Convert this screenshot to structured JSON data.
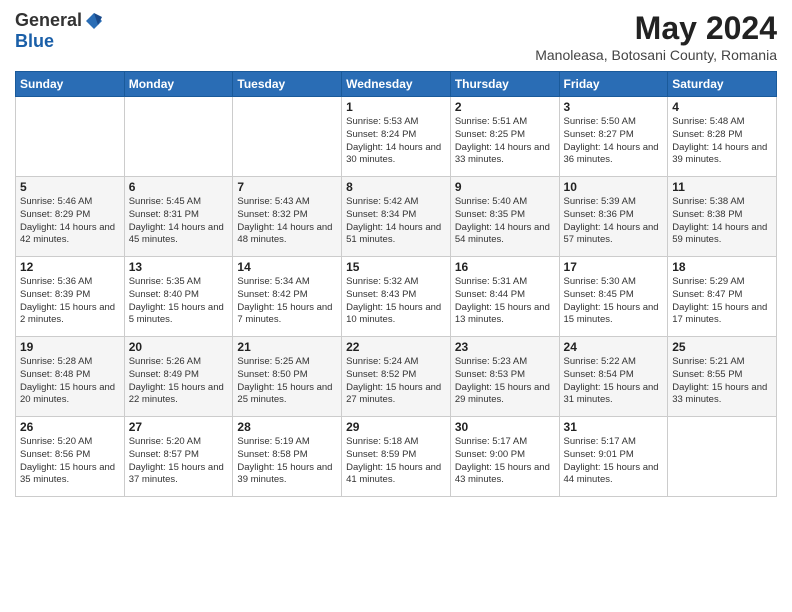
{
  "header": {
    "logo_general": "General",
    "logo_blue": "Blue",
    "title": "May 2024",
    "location": "Manoleasa, Botosani County, Romania"
  },
  "columns": [
    "Sunday",
    "Monday",
    "Tuesday",
    "Wednesday",
    "Thursday",
    "Friday",
    "Saturday"
  ],
  "weeks": [
    [
      {
        "day": "",
        "info": ""
      },
      {
        "day": "",
        "info": ""
      },
      {
        "day": "",
        "info": ""
      },
      {
        "day": "1",
        "info": "Sunrise: 5:53 AM\nSunset: 8:24 PM\nDaylight: 14 hours\nand 30 minutes."
      },
      {
        "day": "2",
        "info": "Sunrise: 5:51 AM\nSunset: 8:25 PM\nDaylight: 14 hours\nand 33 minutes."
      },
      {
        "day": "3",
        "info": "Sunrise: 5:50 AM\nSunset: 8:27 PM\nDaylight: 14 hours\nand 36 minutes."
      },
      {
        "day": "4",
        "info": "Sunrise: 5:48 AM\nSunset: 8:28 PM\nDaylight: 14 hours\nand 39 minutes."
      }
    ],
    [
      {
        "day": "5",
        "info": "Sunrise: 5:46 AM\nSunset: 8:29 PM\nDaylight: 14 hours\nand 42 minutes."
      },
      {
        "day": "6",
        "info": "Sunrise: 5:45 AM\nSunset: 8:31 PM\nDaylight: 14 hours\nand 45 minutes."
      },
      {
        "day": "7",
        "info": "Sunrise: 5:43 AM\nSunset: 8:32 PM\nDaylight: 14 hours\nand 48 minutes."
      },
      {
        "day": "8",
        "info": "Sunrise: 5:42 AM\nSunset: 8:34 PM\nDaylight: 14 hours\nand 51 minutes."
      },
      {
        "day": "9",
        "info": "Sunrise: 5:40 AM\nSunset: 8:35 PM\nDaylight: 14 hours\nand 54 minutes."
      },
      {
        "day": "10",
        "info": "Sunrise: 5:39 AM\nSunset: 8:36 PM\nDaylight: 14 hours\nand 57 minutes."
      },
      {
        "day": "11",
        "info": "Sunrise: 5:38 AM\nSunset: 8:38 PM\nDaylight: 14 hours\nand 59 minutes."
      }
    ],
    [
      {
        "day": "12",
        "info": "Sunrise: 5:36 AM\nSunset: 8:39 PM\nDaylight: 15 hours\nand 2 minutes."
      },
      {
        "day": "13",
        "info": "Sunrise: 5:35 AM\nSunset: 8:40 PM\nDaylight: 15 hours\nand 5 minutes."
      },
      {
        "day": "14",
        "info": "Sunrise: 5:34 AM\nSunset: 8:42 PM\nDaylight: 15 hours\nand 7 minutes."
      },
      {
        "day": "15",
        "info": "Sunrise: 5:32 AM\nSunset: 8:43 PM\nDaylight: 15 hours\nand 10 minutes."
      },
      {
        "day": "16",
        "info": "Sunrise: 5:31 AM\nSunset: 8:44 PM\nDaylight: 15 hours\nand 13 minutes."
      },
      {
        "day": "17",
        "info": "Sunrise: 5:30 AM\nSunset: 8:45 PM\nDaylight: 15 hours\nand 15 minutes."
      },
      {
        "day": "18",
        "info": "Sunrise: 5:29 AM\nSunset: 8:47 PM\nDaylight: 15 hours\nand 17 minutes."
      }
    ],
    [
      {
        "day": "19",
        "info": "Sunrise: 5:28 AM\nSunset: 8:48 PM\nDaylight: 15 hours\nand 20 minutes."
      },
      {
        "day": "20",
        "info": "Sunrise: 5:26 AM\nSunset: 8:49 PM\nDaylight: 15 hours\nand 22 minutes."
      },
      {
        "day": "21",
        "info": "Sunrise: 5:25 AM\nSunset: 8:50 PM\nDaylight: 15 hours\nand 25 minutes."
      },
      {
        "day": "22",
        "info": "Sunrise: 5:24 AM\nSunset: 8:52 PM\nDaylight: 15 hours\nand 27 minutes."
      },
      {
        "day": "23",
        "info": "Sunrise: 5:23 AM\nSunset: 8:53 PM\nDaylight: 15 hours\nand 29 minutes."
      },
      {
        "day": "24",
        "info": "Sunrise: 5:22 AM\nSunset: 8:54 PM\nDaylight: 15 hours\nand 31 minutes."
      },
      {
        "day": "25",
        "info": "Sunrise: 5:21 AM\nSunset: 8:55 PM\nDaylight: 15 hours\nand 33 minutes."
      }
    ],
    [
      {
        "day": "26",
        "info": "Sunrise: 5:20 AM\nSunset: 8:56 PM\nDaylight: 15 hours\nand 35 minutes."
      },
      {
        "day": "27",
        "info": "Sunrise: 5:20 AM\nSunset: 8:57 PM\nDaylight: 15 hours\nand 37 minutes."
      },
      {
        "day": "28",
        "info": "Sunrise: 5:19 AM\nSunset: 8:58 PM\nDaylight: 15 hours\nand 39 minutes."
      },
      {
        "day": "29",
        "info": "Sunrise: 5:18 AM\nSunset: 8:59 PM\nDaylight: 15 hours\nand 41 minutes."
      },
      {
        "day": "30",
        "info": "Sunrise: 5:17 AM\nSunset: 9:00 PM\nDaylight: 15 hours\nand 43 minutes."
      },
      {
        "day": "31",
        "info": "Sunrise: 5:17 AM\nSunset: 9:01 PM\nDaylight: 15 hours\nand 44 minutes."
      },
      {
        "day": "",
        "info": ""
      }
    ]
  ]
}
